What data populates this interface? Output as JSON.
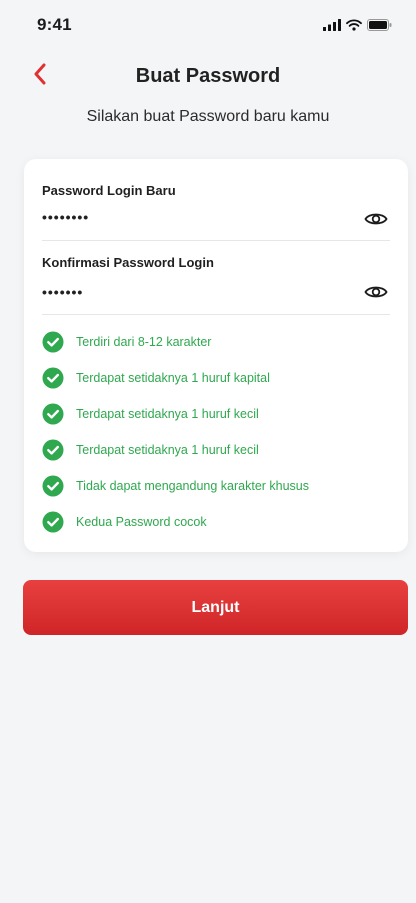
{
  "status_bar": {
    "time": "9:41",
    "icons": [
      "signal-icon",
      "wifi-icon",
      "battery-icon"
    ]
  },
  "header": {
    "title": "Buat Password",
    "back_icon": "chevron-left-icon"
  },
  "subtitle": "Silakan buat Password baru kamu",
  "form": {
    "new_password": {
      "label": "Password Login Baru",
      "value": "••••••••",
      "toggle_icon": "eye-icon"
    },
    "confirm_password": {
      "label": "Konfirmasi Password Login",
      "value": "•••••••",
      "toggle_icon": "eye-icon"
    }
  },
  "rules": [
    {
      "text": "Terdiri dari 8-12 karakter",
      "status": "valid"
    },
    {
      "text": "Terdapat setidaknya 1 huruf kapital",
      "status": "valid"
    },
    {
      "text": "Terdapat setidaknya 1 huruf kecil",
      "status": "valid"
    },
    {
      "text": "Terdapat setidaknya 1 huruf kecil",
      "status": "valid"
    },
    {
      "text": "Tidak dapat mengandung karakter khusus",
      "status": "valid"
    },
    {
      "text": "Kedua Password cocok",
      "status": "valid"
    }
  ],
  "submit_button": {
    "label": "Lanjut"
  },
  "colors": {
    "accent": "#e03131",
    "valid": "#2fa84f",
    "background": "#f4f5f7",
    "card": "#ffffff"
  }
}
